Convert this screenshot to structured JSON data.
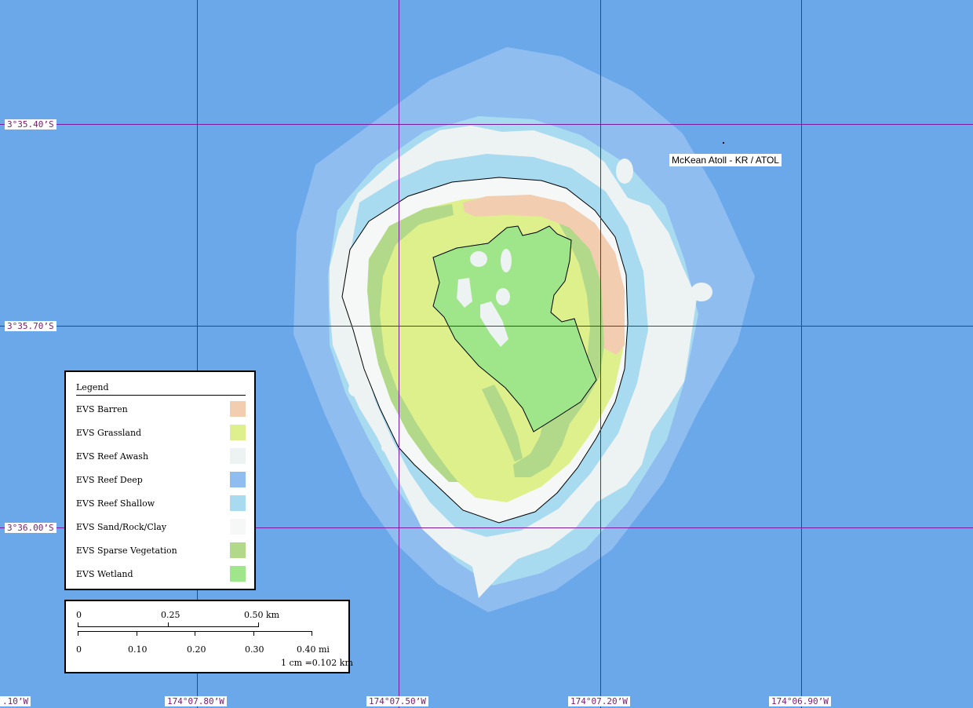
{
  "map": {
    "colors": {
      "ocean": "#6aa8ea",
      "reef_deep": "#8fbdf0",
      "reef_shallow": "#a8daf0",
      "reef_awash": "#edf2f3",
      "sand": "#f6f8f8",
      "barren": "#f2cdb0",
      "grassland": "#def08c",
      "sparse_vegetation": "#b2d88a",
      "wetland": "#9fe68a",
      "grid": "#7a1a9e"
    },
    "place_label": "McKean Atoll - KR / ATOL",
    "lat_labels": [
      "3°35.40’S",
      "3°35.70’S",
      "3°36.00’S"
    ],
    "lon_labels": [
      ".10’W",
      "174°07.80’W",
      "174°07.50’W",
      "174°07.20’W",
      "174°06.90’W"
    ]
  },
  "legend": {
    "title": "Legend",
    "items": [
      {
        "label": "EVS Barren",
        "color": "#f2cdb0"
      },
      {
        "label": "EVS Grassland",
        "color": "#def08c"
      },
      {
        "label": "EVS Reef Awash",
        "color": "#edf2f3"
      },
      {
        "label": "EVS Reef Deep",
        "color": "#8fbdf0"
      },
      {
        "label": "EVS Reef Shallow",
        "color": "#a8daf0"
      },
      {
        "label": "EVS Sand/Rock/Clay",
        "color": "#f6f8f8"
      },
      {
        "label": "EVS Sparse Vegetation",
        "color": "#b2d88a"
      },
      {
        "label": "EVS Wetland",
        "color": "#9fe68a"
      }
    ]
  },
  "scalebar": {
    "km_ticks": [
      "0",
      "0.25",
      "0.50 km"
    ],
    "mi_ticks": [
      "0",
      "0.10",
      "0.20",
      "0.30",
      "0.40 mi"
    ],
    "ratio": "1 cm =0.102 km"
  }
}
